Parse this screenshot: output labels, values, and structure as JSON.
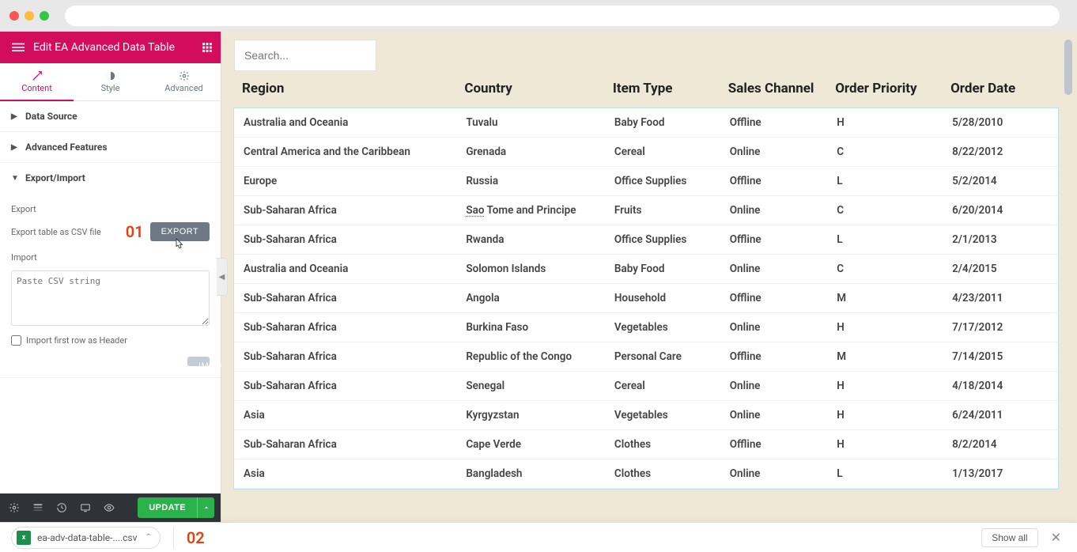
{
  "header": {
    "title": "Edit EA Advanced Data Table"
  },
  "tabs": {
    "content": "Content",
    "style": "Style",
    "advanced": "Advanced"
  },
  "accordions": {
    "data_source": "Data Source",
    "advanced_features": "Advanced Features",
    "export_import": "Export/Import"
  },
  "export_section": {
    "heading": "Export",
    "hint": "Export table as CSV file",
    "button": "EXPORT",
    "marker": "01"
  },
  "import_section": {
    "heading": "Import",
    "placeholder": "Paste CSV string",
    "checkbox_label": "Import first row as Header",
    "button": "IMPORT"
  },
  "bottom": {
    "update": "UPDATE"
  },
  "search": {
    "placeholder": "Search..."
  },
  "table": {
    "headers": [
      "Region",
      "Country",
      "Item Type",
      "Sales Channel",
      "Order Priority",
      "Order Date"
    ],
    "rows": [
      {
        "region": "Australia and Oceania",
        "country": "Tuvalu",
        "country_flag": "",
        "item": "Baby Food",
        "channel": "Offline",
        "priority": "H",
        "date": "5/28/2010"
      },
      {
        "region": "Central America and the Caribbean",
        "country": "Grenada",
        "item": "Cereal",
        "channel": "Online",
        "priority": "C",
        "date": "8/22/2012"
      },
      {
        "region": "Europe",
        "country": "Russia",
        "item": "Office Supplies",
        "channel": "Offline",
        "priority": "L",
        "date": "5/2/2014"
      },
      {
        "region": "Sub-Saharan Africa",
        "country": "Sao Tome and Principe",
        "country_flag": "sao",
        "item": "Fruits",
        "channel": "Online",
        "priority": "C",
        "date": "6/20/2014"
      },
      {
        "region": "Sub-Saharan Africa",
        "country": "Rwanda",
        "item": "Office Supplies",
        "channel": "Offline",
        "priority": "L",
        "date": "2/1/2013"
      },
      {
        "region": "Australia and Oceania",
        "country": "Solomon Islands",
        "item": "Baby Food",
        "channel": "Online",
        "priority": "C",
        "date": "2/4/2015"
      },
      {
        "region": "Sub-Saharan Africa",
        "country": "Angola",
        "item": "Household",
        "channel": "Offline",
        "priority": "M",
        "date": "4/23/2011"
      },
      {
        "region": "Sub-Saharan Africa",
        "country": "Burkina Faso",
        "item": "Vegetables",
        "channel": "Online",
        "priority": "H",
        "date": "7/17/2012"
      },
      {
        "region": "Sub-Saharan Africa",
        "country": "Republic of the Congo",
        "item": "Personal Care",
        "channel": "Offline",
        "priority": "M",
        "date": "7/14/2015"
      },
      {
        "region": "Sub-Saharan Africa",
        "country": "Senegal",
        "item": "Cereal",
        "channel": "Online",
        "priority": "H",
        "date": "4/18/2014"
      },
      {
        "region": "Asia",
        "country": "Kyrgyzstan",
        "item": "Vegetables",
        "channel": "Online",
        "priority": "H",
        "date": "6/24/2011"
      },
      {
        "region": "Sub-Saharan Africa",
        "country": "Cape Verde",
        "item": "Clothes",
        "channel": "Offline",
        "priority": "H",
        "date": "8/2/2014"
      },
      {
        "region": "Asia",
        "country": "Bangladesh",
        "item": "Clothes",
        "channel": "Online",
        "priority": "L",
        "date": "1/13/2017"
      }
    ]
  },
  "download": {
    "filename": "ea-adv-data-table-....csv",
    "marker": "02",
    "show_all": "Show all"
  }
}
